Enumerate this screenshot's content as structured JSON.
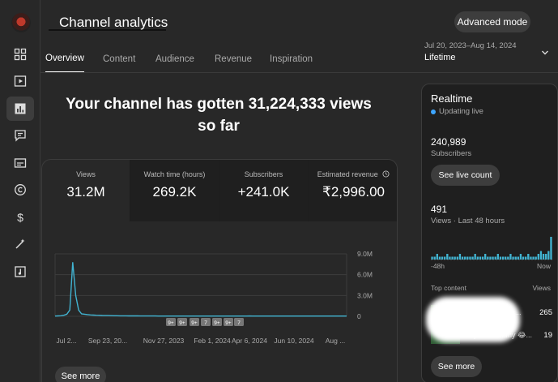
{
  "header": {
    "title": "Channel analytics",
    "advanced_mode": "Advanced mode",
    "date_range": "Jul 20, 2023–Aug 14, 2024",
    "period": "Lifetime"
  },
  "tabs": [
    {
      "label": "Overview",
      "active": true
    },
    {
      "label": "Content",
      "active": false
    },
    {
      "label": "Audience",
      "active": false
    },
    {
      "label": "Revenue",
      "active": false
    },
    {
      "label": "Inspiration",
      "active": false
    }
  ],
  "banner": {
    "line1": "Your channel has gotten 31,224,333 views",
    "line2": "so far"
  },
  "metrics": [
    {
      "label": "Views",
      "value": "31.2M"
    },
    {
      "label": "Watch time (hours)",
      "value": "269.2K"
    },
    {
      "label": "Subscribers",
      "value": "+241.0K"
    },
    {
      "label": "Estimated revenue",
      "value": "₹2,996.00"
    }
  ],
  "sidebar_icons": [
    "dashboard-icon",
    "content-icon",
    "analytics-icon",
    "comments-icon",
    "subtitles-icon",
    "copyright-icon",
    "earn-icon",
    "customization-icon",
    "audio-library-icon"
  ],
  "chart_data": {
    "type": "line",
    "x_tick_labels": [
      "Jul 2...",
      "Sep 23, 20...",
      "Nov 27, 2023",
      "Feb 1, 2024",
      "Apr 6, 2024",
      "Jun 10, 2024",
      "Aug ..."
    ],
    "y_tick_labels": [
      "9.0M",
      "6.0M",
      "3.0M",
      "0"
    ],
    "ylim": [
      0,
      9000000
    ],
    "series": [
      {
        "color": "#41b4d2",
        "values": [
          40000,
          60000,
          80000,
          150000,
          300000,
          900000,
          7800000,
          3000000,
          900000,
          350000,
          300000,
          250000,
          200000,
          180000,
          150000,
          140000,
          120000,
          110000,
          100000,
          90000,
          85000,
          80000,
          75000,
          70000,
          65000,
          60000,
          60000,
          55000,
          55000,
          50000,
          50000,
          50000,
          45000,
          45000,
          45000,
          40000,
          40000,
          40000,
          40000,
          35000,
          35000,
          35000,
          35000,
          30000,
          30000,
          30000,
          30000,
          30000,
          30000,
          30000,
          30000,
          30000,
          30000,
          30000,
          30000,
          30000,
          30000,
          30000,
          35000,
          35000,
          30000,
          30000,
          30000,
          35000,
          40000,
          40000,
          45000,
          40000,
          35000,
          35000,
          30000,
          30000,
          30000,
          30000,
          30000,
          30000,
          30000,
          30000,
          30000,
          30000,
          30000,
          30000,
          30000,
          30000,
          30000,
          30000,
          30000,
          30000,
          30000,
          30000,
          30000,
          30000,
          30000,
          30000,
          30000,
          30000,
          30000,
          30000,
          30000,
          30000
        ]
      }
    ],
    "markers": [
      "9+",
      "9+",
      "9+",
      "7",
      "9+",
      "9+",
      "7"
    ],
    "grid": true
  },
  "see_more_main": "See more",
  "realtime": {
    "title": "Realtime",
    "status": "Updating live",
    "subscribers": "240,989",
    "subscribers_label": "Subscribers",
    "see_live_count": "See live count",
    "views": "491",
    "views_label": "Views · Last 48 hours",
    "axis_start": "-48h",
    "axis_end": "Now",
    "top_content_label": "Top content",
    "views_col_label": "Views",
    "bars": [
      1,
      1,
      2,
      1,
      1,
      1,
      2,
      1,
      1,
      1,
      1,
      2,
      1,
      1,
      1,
      1,
      1,
      2,
      1,
      1,
      1,
      2,
      1,
      1,
      1,
      1,
      2,
      1,
      1,
      1,
      1,
      2,
      1,
      1,
      1,
      2,
      1,
      1,
      2,
      1,
      1,
      1,
      2,
      3,
      2,
      2,
      3,
      8
    ],
    "top_content": [
      {
        "label": "...ian ..indian s...",
        "value": "265"
      },
      {
        "label": "...jomi Mummy 😂...",
        "value": "19"
      }
    ],
    "see_more": "See more"
  }
}
